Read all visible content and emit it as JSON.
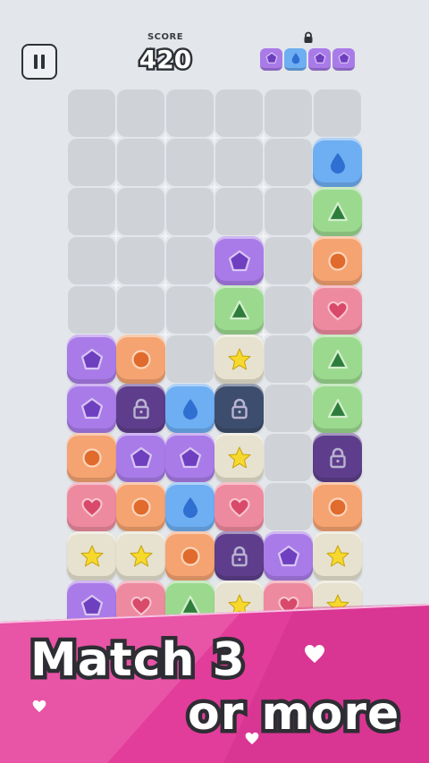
{
  "header": {
    "pause_icon": "pause-icon",
    "score_label": "SCORE",
    "score_value": "420",
    "next_lock_icon": "lock-icon",
    "next_queue": [
      {
        "color": "purple",
        "shape": "pentagon"
      },
      {
        "color": "blue",
        "shape": "drop"
      },
      {
        "color": "purple",
        "shape": "pentagon"
      },
      {
        "color": "purple",
        "shape": "pentagon"
      }
    ]
  },
  "board": {
    "cols": 6,
    "visible_rows": 11,
    "rows": [
      [
        null,
        null,
        null,
        null,
        null,
        null
      ],
      [
        null,
        null,
        null,
        null,
        null,
        "blue-drop"
      ],
      [
        null,
        null,
        null,
        null,
        null,
        "green-triangle"
      ],
      [
        null,
        null,
        null,
        "purple-pentagon",
        null,
        "orange-circle"
      ],
      [
        null,
        null,
        null,
        "green-triangle",
        null,
        "pink-heart"
      ],
      [
        "purple-pentagon",
        "orange-circle",
        null,
        "cream-star",
        null,
        "green-triangle"
      ],
      [
        "purple-pentagon",
        "purple-lock",
        "blue-drop",
        "navy-lock",
        null,
        "green-triangle"
      ],
      [
        "orange-circle",
        "purple-pentagon",
        "purple-pentagon",
        "cream-star",
        null,
        "purple-lock"
      ],
      [
        "pink-heart",
        "orange-circle",
        "blue-drop",
        "pink-heart",
        null,
        "orange-circle"
      ],
      [
        "cream-star",
        "cream-star",
        "orange-circle",
        "purple-lock",
        "purple-pentagon",
        "cream-star"
      ],
      [
        "purple-pentagon",
        "pink-heart",
        "green-triangle",
        "cream-star",
        "pink-heart",
        "cream-star"
      ]
    ]
  },
  "banner": {
    "line1": "Match 3",
    "line2": "or more"
  },
  "colors": {
    "background": "#e3e6ea",
    "banner_pink": "#e23d9a",
    "banner_light": "#f2a1d0",
    "purple": "#a97be8",
    "blue": "#6eaef2",
    "green": "#9bd98f",
    "orange": "#f5a371",
    "pink": "#ee8a9f",
    "cream": "#e6e2cf",
    "dark_purple": "#5e3e8c",
    "navy": "#3d4d6d",
    "star_yellow": "#f6d92c"
  }
}
